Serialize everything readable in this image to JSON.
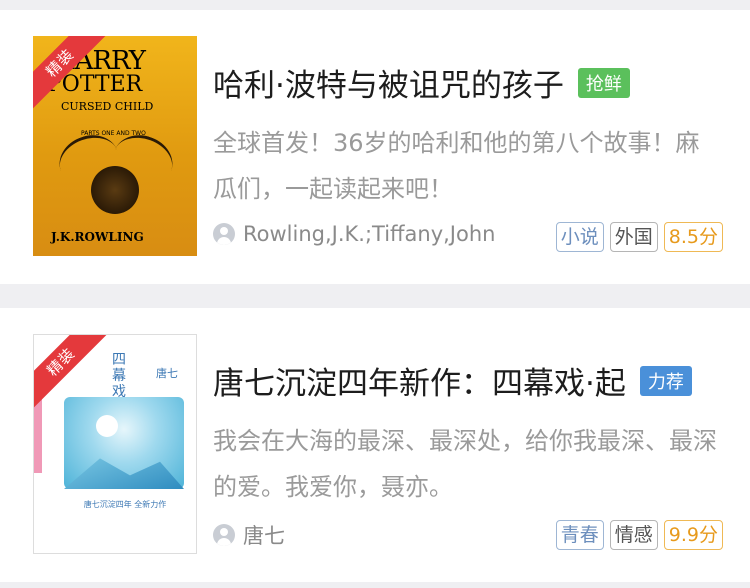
{
  "books": [
    {
      "ribbon": "精装",
      "title": "哈利·波特与被诅咒的孩子",
      "tag": {
        "label": "抢鲜",
        "color": "#5bc05c"
      },
      "description": "全球首发！36岁的哈利和他的第八个故事！麻瓜们，一起读起来吧！",
      "author": "Rowling,J.K.;Tiffany,John",
      "badges": [
        "小说",
        "外国",
        "8.5分"
      ],
      "cover": {
        "title_line1": "HARRY",
        "title_line2": "POTTER",
        "subtitle": "CURSED CHILD",
        "note": "PARTS ONE AND TWO",
        "author": "J.K.ROWLING"
      }
    },
    {
      "ribbon": "精装",
      "title": "唐七沉淀四年新作：四幕戏·起",
      "tag": {
        "label": "力荐",
        "color": "#4a90d9"
      },
      "description": "我会在大海的最深、最深处，给你我最深、最深的爱。我爱你，聂亦。",
      "author": "唐七",
      "badges": [
        "青春",
        "情感",
        "9.9分"
      ],
      "cover": {
        "title_a": "四",
        "title_b": "幕",
        "title_c": "戏",
        "name": "唐七",
        "caption": "唐七沉淀四年 全新力作"
      }
    }
  ]
}
